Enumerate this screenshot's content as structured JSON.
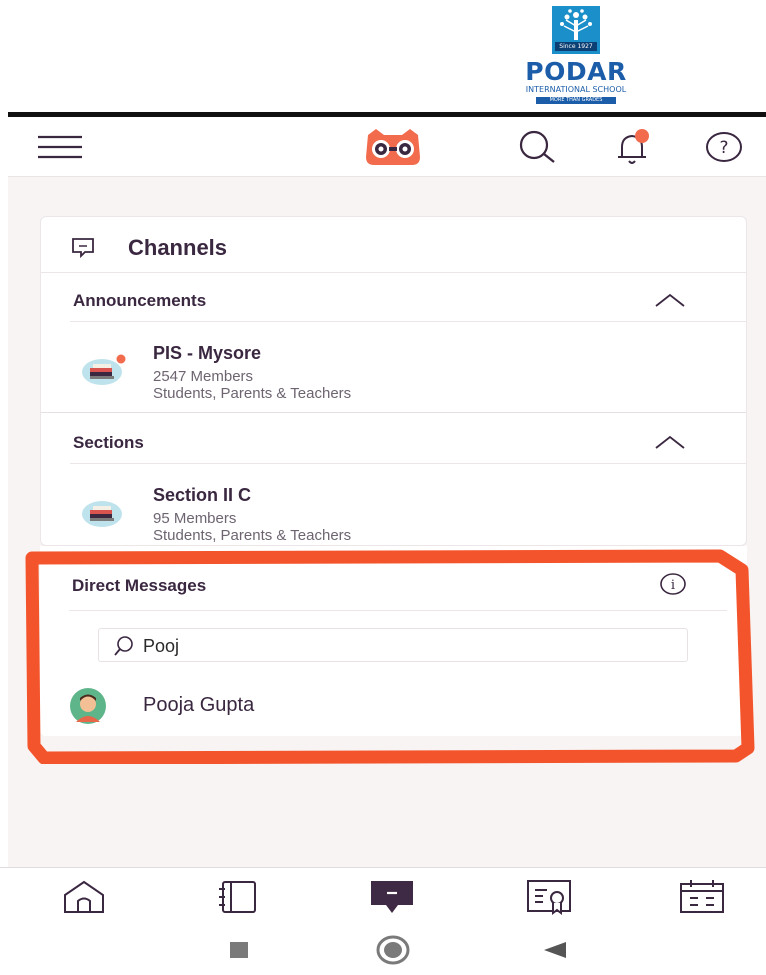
{
  "logo": {
    "since": "Since 1927",
    "brand": "PODAR",
    "school": "INTERNATIONAL SCHOOL",
    "tagline": "MORE THAN GRADES"
  },
  "header": {
    "icons": [
      "hamburger-menu-icon",
      "owl-logo-icon",
      "search-icon",
      "notification-bell-icon",
      "help-icon"
    ],
    "accent_color": "#f26b4d"
  },
  "channels": {
    "title": "Channels",
    "announcements": {
      "label": "Announcements",
      "items": [
        {
          "name": "PIS - Mysore",
          "members": "2547 Members",
          "audience": "Students, Parents & Teachers",
          "has_unread_dot": true
        }
      ]
    },
    "sections": {
      "label": "Sections",
      "items": [
        {
          "name": "Section II C",
          "members": "95 Members",
          "audience": "Students, Parents & Teachers",
          "has_unread_dot": false
        }
      ]
    }
  },
  "direct_messages": {
    "label": "Direct Messages",
    "search_value": "Pooj",
    "results": [
      {
        "name": "Pooja Gupta"
      }
    ]
  },
  "annotation": {
    "highlight_color": "#f4542b"
  },
  "tabbar": {
    "tabs": [
      "home-icon",
      "notebook-icon",
      "messages-icon",
      "certificate-icon",
      "calendar-icon"
    ],
    "active": "messages-icon",
    "active_color": "#3f2a45"
  },
  "sysnav": {
    "buttons": [
      "recents-button",
      "home-button",
      "back-button"
    ]
  }
}
